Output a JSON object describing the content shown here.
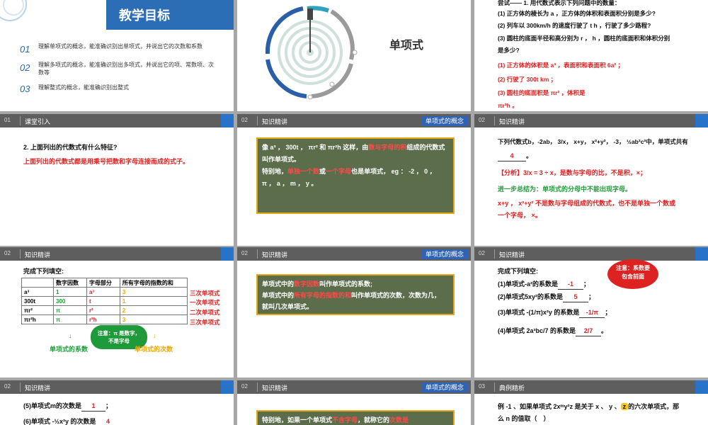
{
  "slide1": {
    "title": "教学目标",
    "goals": [
      {
        "num": "01",
        "text": "理解单项式的概念，能准确识别出单项式，并说出它的次数和系数"
      },
      {
        "num": "02",
        "text": "理解多项式的概念，能准确识别出多项式，并说出它的项、常数项、次数等"
      },
      {
        "num": "03",
        "text": "理解整式的概念，能准确识别出整式"
      }
    ]
  },
  "slide2": {
    "title": "单项式"
  },
  "slide3": {
    "intro": "尝试—— 1. 用代数式表示下列问题中的数量：",
    "q1": "(1) 正方体的棱长为 a ，正方体的体积和表面积分别是多少?",
    "q2": "(2) 列车以 300km/h 的速度行驶了 t h ，行驶了多少路程?",
    "q3a": "(3) 圆柱的底面半径和高分别为 r ， h ，圆柱的底面积和体积分别",
    "q3b": "是多少?",
    "a1": "(1) 正方体的体积是 a³ ，表面积和表面积 6a² ；",
    "a2": "(2) 行驶了 300t km ；",
    "a3": "(3) 圆柱的底面积是 πr² ，体积是",
    "a3b": "πr²h 。"
  },
  "slide4": {
    "num": "01",
    "header": "课堂引入",
    "q": "2. 上面列出的代数式有什么特征?",
    "a": "上面列出的代数式都是用乘号把数和字母连接而成的式子。"
  },
  "slide5": {
    "num": "02",
    "header": "知识精讲",
    "tag": "单项式的概念",
    "l1a": "像 a³ ， 300t ， πr² 和 πr²h 这样，由",
    "l1hl": "数与字母的积",
    "l1b": "组成的代数式",
    "l2": "叫作单项式。",
    "l3a": "特别地，",
    "l3hl1": "单独一个数",
    "l3b": "或",
    "l3hl2": "一个字母",
    "l3c": "也是单项式， eg ： -2 ， 0 ，",
    "l4": "π ， a ， m ， y 。"
  },
  "slide6": {
    "num": "02",
    "header": "知识精讲",
    "q": "下列代数式b，-2ab， 3/x， x+y， x²+y²， -3， ½ab²c³中，单项式共有",
    "ans": "4",
    "end": "。",
    "analysis_label": "【分析】",
    "analysis": "3/x = 3 ÷ x，是数与字母的比，不是积，×；",
    "summary": "进一步总结为：单项式的分母中不能出现字母。",
    "note1": "x+y ， x²+y² 不是数与字母组成的代数式，也不是单独一个数或",
    "note2": "一个字母， ×。"
  },
  "slide7": {
    "num": "02",
    "header": "知识精讲",
    "title": "完成下列填空:",
    "headers": [
      "",
      "数字因数",
      "字母部分",
      "所有字母的指数的和"
    ],
    "rows": [
      {
        "expr": "a³",
        "coef": "1",
        "letters": "a³",
        "deg": "3",
        "label": "三次单项式"
      },
      {
        "expr": "300t",
        "coef": "300",
        "letters": "t",
        "deg": "1",
        "label": "一次单项式"
      },
      {
        "expr": "πr²",
        "coef": "π",
        "letters": "r²",
        "deg": "2",
        "label": "二次单项式"
      },
      {
        "expr": "πr²h",
        "coef": "π",
        "letters": "r²h",
        "deg": "3",
        "label": "三次单项式"
      }
    ],
    "note": "注意：π 是数字，不是字母",
    "coef_caption": "单项式的系数",
    "deg_caption": "单项式的次数"
  },
  "slide8": {
    "num": "02",
    "header": "知识精讲",
    "tag": "单项式的概念",
    "l1a": "单项式中的",
    "l1hl": "数字因数",
    "l1b": "叫作单项式的系数;",
    "l2a": "单项式中的",
    "l2hl": "所有字母的指数的和",
    "l2b": "叫作单项式的次数，次数为几，",
    "l3": "就叫几次单项式。"
  },
  "slide9": {
    "num": "02",
    "header": "知识精讲",
    "title": "完成下列填空:",
    "items": [
      {
        "q": "(1)单项式-a²的系数是",
        "a": "-1"
      },
      {
        "q": "(2)单项式5xy²的系数是",
        "a": "5"
      },
      {
        "q": "(3)单项式 -(1/π)x²y 的系数是",
        "a": "-1/π"
      },
      {
        "q": "(4)单项式 2a³bc/7 的系数是",
        "a": "2/7"
      }
    ],
    "note": "注意：系数要包含前面"
  },
  "slide10": {
    "num": "02",
    "header": "知识精讲",
    "i1": "(5)单项式m的次数是",
    "a1": "1",
    "i2": "(6)单项式 -½x²y 的次数是",
    "a2": "4"
  },
  "slide11": {
    "num": "02",
    "header": "知识精讲",
    "tag": "单项式的概念",
    "l1a": "特别地，如果一个单项式",
    "l1hl": "不含字母",
    "l1b": "，就称它的",
    "l1hl2": "次数是"
  },
  "slide12": {
    "num": "03",
    "header": "典例精析",
    "l1a": "例 -1 、如果单项式 2xᵐy²z 是关于 x 、 y 、",
    "l1hl": "z",
    "l1b": "的六次单项式，那",
    "l2": "么 n 的值取（　）"
  }
}
